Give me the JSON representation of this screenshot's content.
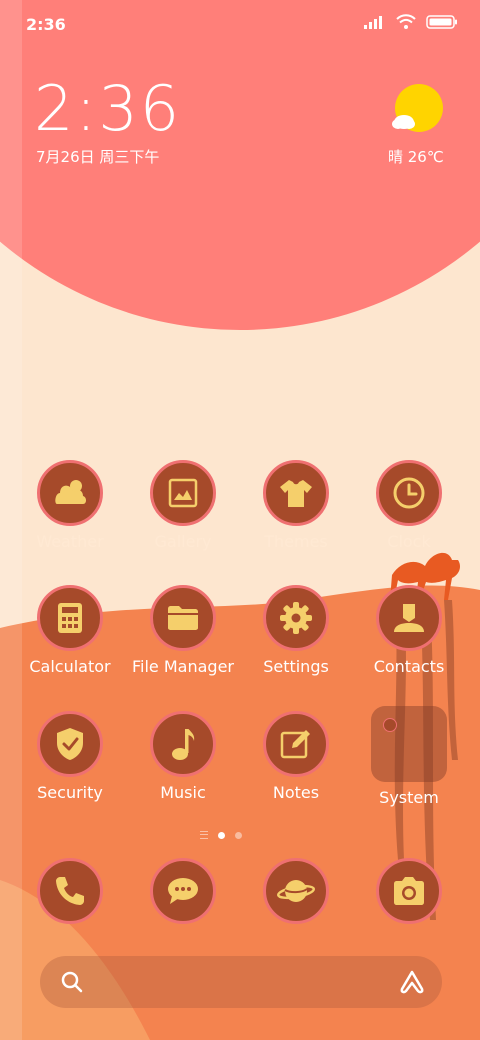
{
  "status_bar": {
    "time": "2:36"
  },
  "clock_widget": {
    "time": "2:36",
    "date": "7月26日 周三下午"
  },
  "weather_widget": {
    "text": "晴 26℃",
    "icon": "sun-with-cloud-icon"
  },
  "apps": [
    {
      "label": "Weather",
      "icon": "weather-icon"
    },
    {
      "label": "Gallery",
      "icon": "gallery-icon"
    },
    {
      "label": "Themes",
      "icon": "tshirt-icon"
    },
    {
      "label": "Clock",
      "icon": "clock-icon"
    },
    {
      "label": "Calculator",
      "icon": "calculator-icon"
    },
    {
      "label": "File Manager",
      "icon": "folder-icon"
    },
    {
      "label": "Settings",
      "icon": "gear-icon"
    },
    {
      "label": "Contacts",
      "icon": "person-icon"
    },
    {
      "label": "Security",
      "icon": "shield-check-icon"
    },
    {
      "label": "Music",
      "icon": "music-note-icon"
    },
    {
      "label": "Notes",
      "icon": "pencil-icon"
    },
    {
      "label": "System",
      "icon": "folder-icon"
    }
  ],
  "dock": [
    {
      "icon": "phone-icon"
    },
    {
      "icon": "message-icon"
    },
    {
      "icon": "planet-icon"
    },
    {
      "icon": "camera-icon"
    }
  ],
  "colors": {
    "accent": "#ef7071",
    "icon_bg": "#a64a2a",
    "icon_glyph": "#f5cf6b",
    "sky": "#fde6cf",
    "sun": "#ff7f79",
    "dune": "#f4834f"
  }
}
